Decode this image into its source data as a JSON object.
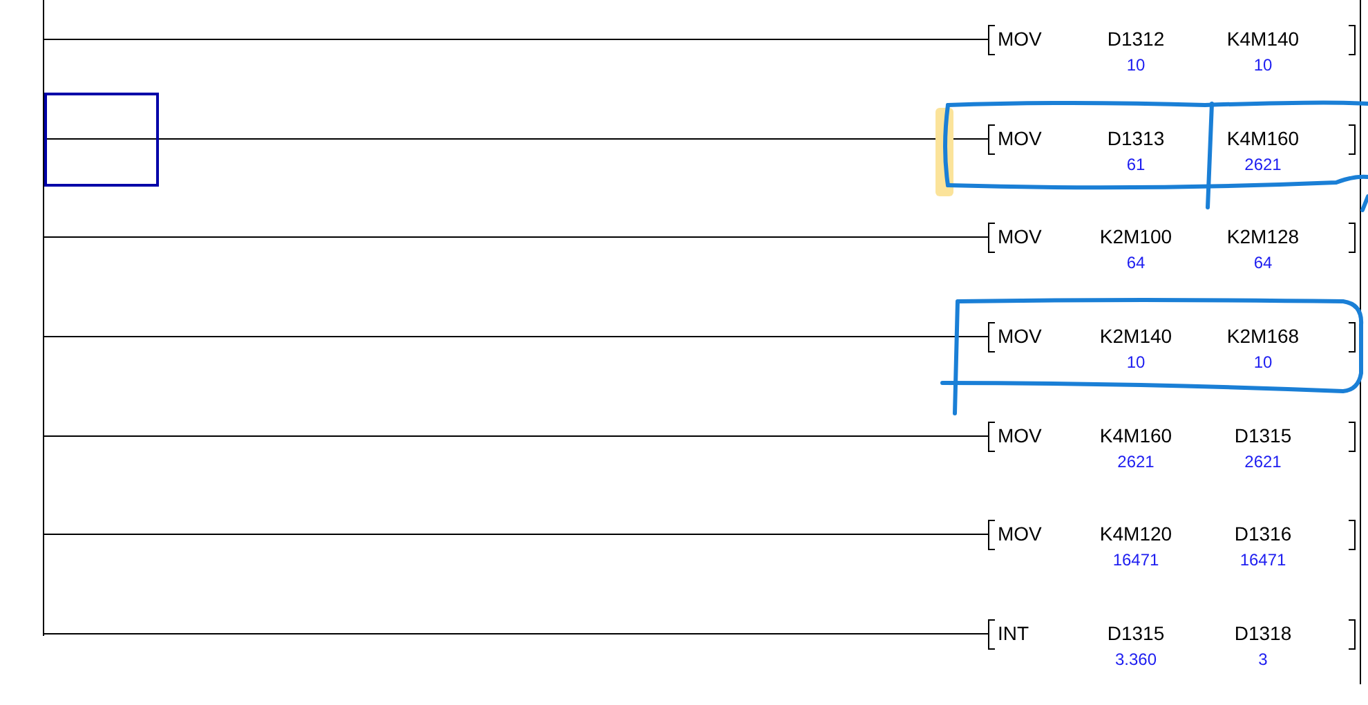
{
  "rungs": [
    {
      "selected": false,
      "instruction": "MOV",
      "operands": [
        {
          "name": "D1312",
          "value": "10"
        },
        {
          "name": "K4M140",
          "value": "10"
        }
      ]
    },
    {
      "selected": true,
      "circled": true,
      "divided": true,
      "highlighted": true,
      "instruction": "MOV",
      "operands": [
        {
          "name": "D1313",
          "value": "61"
        },
        {
          "name": "K4M160",
          "value": "2621"
        }
      ]
    },
    {
      "selected": false,
      "instruction": "MOV",
      "operands": [
        {
          "name": "K2M100",
          "value": "64"
        },
        {
          "name": "K2M128",
          "value": "64"
        }
      ]
    },
    {
      "selected": false,
      "circled": true,
      "divided": false,
      "instruction": "MOV",
      "operands": [
        {
          "name": "K2M140",
          "value": "10"
        },
        {
          "name": "K2M168",
          "value": "10"
        }
      ]
    },
    {
      "selected": false,
      "instruction": "MOV",
      "operands": [
        {
          "name": "K4M160",
          "value": "2621"
        },
        {
          "name": "D1315",
          "value": "2621"
        }
      ]
    },
    {
      "selected": false,
      "instruction": "MOV",
      "operands": [
        {
          "name": "K4M120",
          "value": "16471"
        },
        {
          "name": "D1316",
          "value": "16471"
        }
      ]
    },
    {
      "selected": false,
      "instruction": "INT",
      "operands": [
        {
          "name": "D1315",
          "value": "3.360"
        },
        {
          "name": "D1318",
          "value": "3"
        }
      ]
    }
  ]
}
